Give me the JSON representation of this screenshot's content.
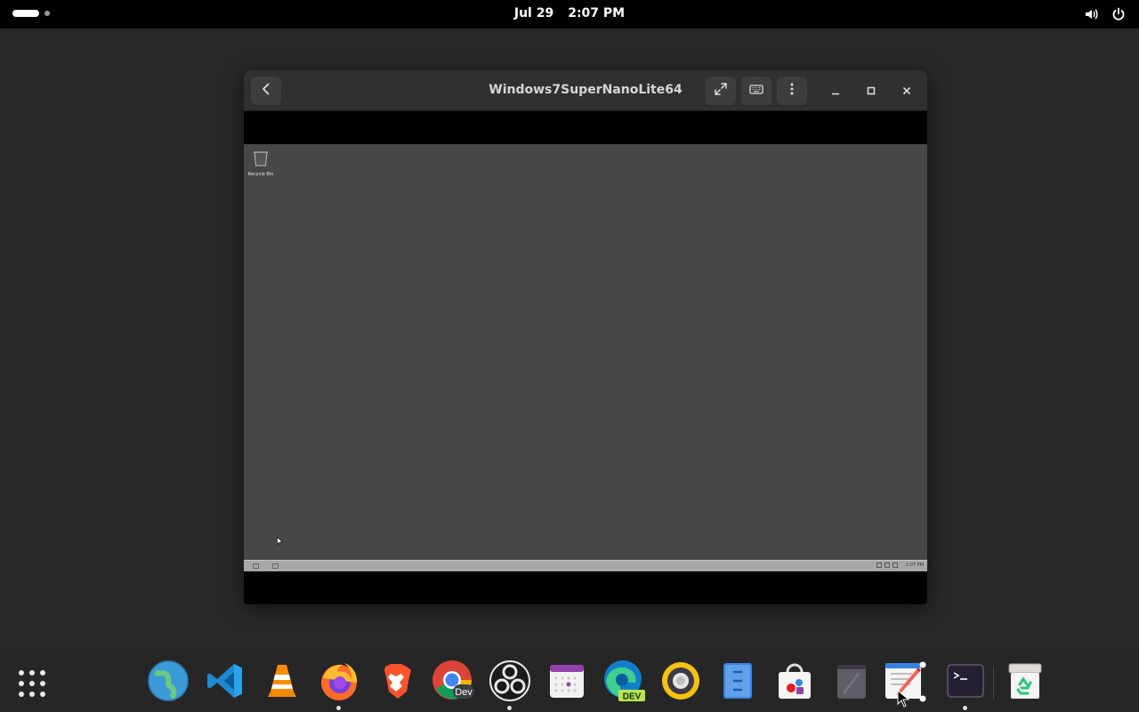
{
  "topbar": {
    "date": "Jul 29",
    "time": "2:07 PM",
    "icons": [
      "activities-indicator",
      "volume-icon",
      "power-icon"
    ]
  },
  "window": {
    "title": "Windows7SuperNanoLite64",
    "buttons": [
      "back-icon",
      "fullscreen-icon",
      "keyboard-icon",
      "menu-icon",
      "minimize-icon",
      "maximize-icon",
      "close-icon"
    ]
  },
  "guest": {
    "desktop_icon_label": "Recycle Bin",
    "taskbar_time": "2:07 PM"
  },
  "dock": {
    "items": [
      {
        "name": "show-apps-icon"
      },
      {
        "name": "web-browser-icon"
      },
      {
        "name": "vscode-icon"
      },
      {
        "name": "vlc-icon"
      },
      {
        "name": "firefox-icon",
        "running": true
      },
      {
        "name": "brave-icon"
      },
      {
        "name": "chrome-dev-icon",
        "badge": "Dev"
      },
      {
        "name": "obs-icon",
        "running": true
      },
      {
        "name": "calendar-icon"
      },
      {
        "name": "edge-dev-icon",
        "badge": "DEV"
      },
      {
        "name": "rhythmbox-icon"
      },
      {
        "name": "file-cabinet-icon"
      },
      {
        "name": "software-store-icon"
      },
      {
        "name": "notes-icon"
      },
      {
        "name": "text-editor-icon"
      },
      {
        "name": "terminal-icon",
        "running": true
      },
      {
        "name": "trash-icon"
      }
    ]
  },
  "colors": {
    "desktop_bg": "#282828",
    "topbar_bg": "#000000",
    "headerbar_bg": "#303030",
    "guest_desktop": "#474747",
    "guest_taskbar": "#a8a8a8",
    "dock_bg": "#262626"
  }
}
